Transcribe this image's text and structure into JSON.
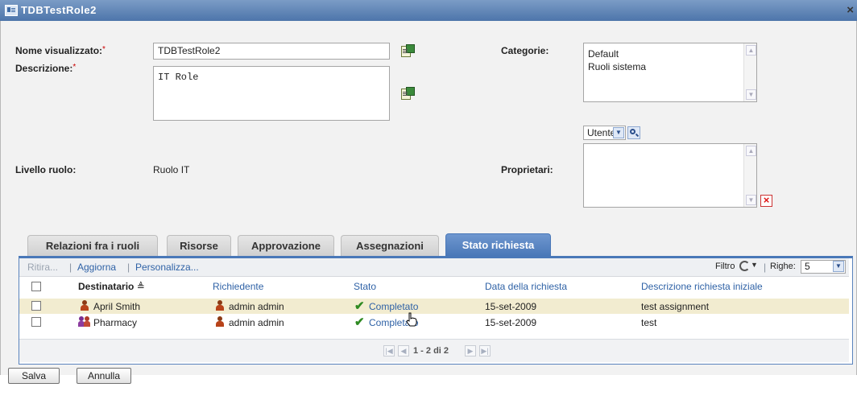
{
  "window": {
    "title": "TDBTestRole2",
    "close_glyph": "×"
  },
  "form": {
    "display_name_label": "Nome visualizzato:",
    "display_name_value": "TDBTestRole2",
    "description_label": "Descrizione:",
    "description_value": "IT Role",
    "required_marker": "*",
    "role_level_label": "Livello ruolo:",
    "role_level_value": "Ruolo IT",
    "categories_label": "Categorie:",
    "categories": [
      "Default",
      "Ruoli sistema"
    ],
    "owners_label": "Proprietari:",
    "owner_type_selected": "Utente"
  },
  "tabs": [
    {
      "label": "Relazioni fra i ruoli",
      "active": false
    },
    {
      "label": "Risorse",
      "active": false
    },
    {
      "label": "Approvazione",
      "active": false
    },
    {
      "label": "Assegnazioni",
      "active": false
    },
    {
      "label": "Stato richiesta",
      "active": true
    }
  ],
  "toolbar": {
    "retract": "Ritira...",
    "refresh": "Aggiorna",
    "customize": "Personalizza...",
    "sep": "|",
    "filter_label": "Filtro",
    "rows_label": "Righe:",
    "rows_value": "5"
  },
  "table": {
    "columns": [
      "Destinatario",
      "Richiedente",
      "Stato",
      "Data della richiesta",
      "Descrizione richiesta iniziale"
    ],
    "sort_glyph": "≜",
    "rows": [
      {
        "recipient": "April Smith",
        "recipient_icon": "user-icon",
        "requester": "admin admin",
        "status": "Completato",
        "date": "15-set-2009",
        "description": "test assignment",
        "highlighted": true
      },
      {
        "recipient": "Pharmacy",
        "recipient_icon": "group-icon",
        "requester": "admin admin",
        "status": "Completato",
        "date": "15-set-2009",
        "description": "test",
        "highlighted": false
      }
    ]
  },
  "pager": {
    "text": "1 - 2 di 2"
  },
  "buttons": {
    "save": "Salva",
    "cancel": "Annulla"
  },
  "colors": {
    "accent": "#4a78b8",
    "link": "#2f62a6",
    "highlight_row": "#f2ecd0",
    "status_ok": "#2f8a22",
    "delete": "#d11111"
  }
}
